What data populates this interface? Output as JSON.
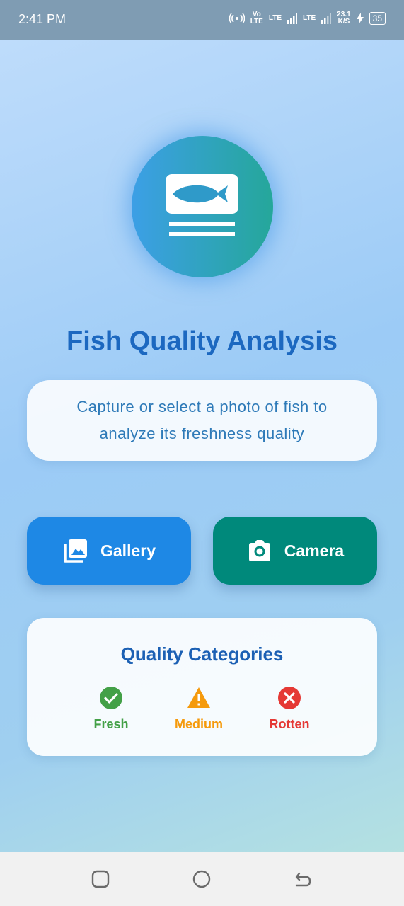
{
  "status_bar": {
    "time": "2:41 PM",
    "vo_lte_top": "Vo",
    "vo_lte_bottom": "LTE",
    "lte1": "LTE",
    "lte2": "LTE",
    "speed_value": "23.1",
    "speed_unit": "K/S",
    "battery": "35"
  },
  "header": {
    "title": "Fish Quality Analysis",
    "subtitle": "Capture or select a photo of fish to analyze its freshness quality"
  },
  "actions": {
    "gallery_label": "Gallery",
    "camera_label": "Camera"
  },
  "quality": {
    "title": "Quality Categories",
    "categories": [
      {
        "label": "Fresh",
        "icon": "check-circle-icon",
        "color": "#43a047"
      },
      {
        "label": "Medium",
        "icon": "warning-icon",
        "color": "#f59a0c"
      },
      {
        "label": "Rotten",
        "icon": "x-circle-icon",
        "color": "#e53935"
      }
    ]
  },
  "colors": {
    "title": "#1c68c0",
    "gallery_button": "#1e88e5",
    "camera_button": "#00897b"
  }
}
